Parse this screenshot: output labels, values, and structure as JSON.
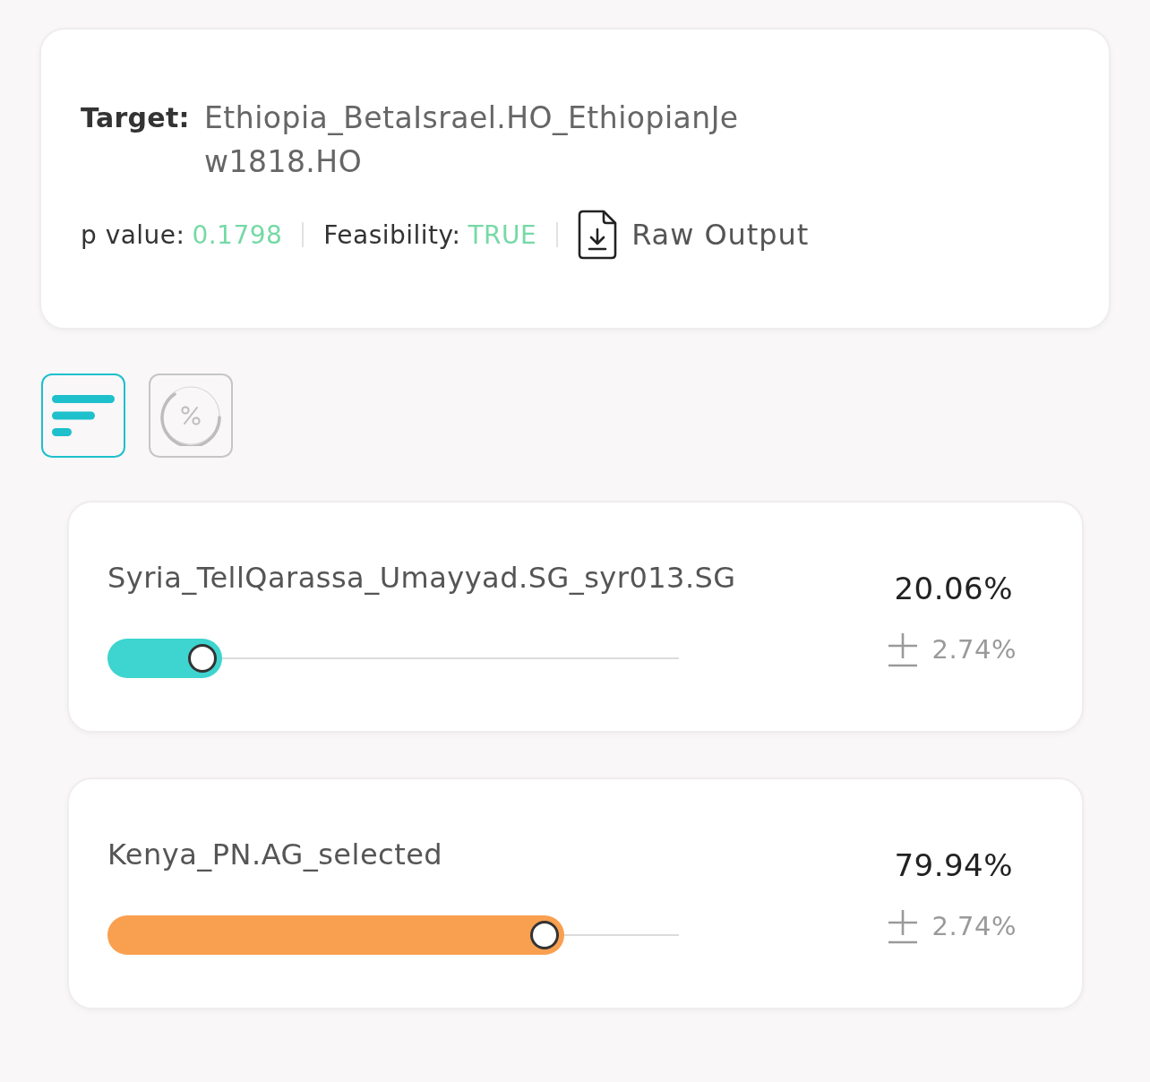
{
  "target": {
    "label": "Target:",
    "value": "Ethiopia_BetaIsrael.HO_EthiopianJew1818.HO"
  },
  "stats": [
    {
      "label": "p value:",
      "value": "0.1798"
    },
    {
      "label": "Feasibility:",
      "value": "TRUE"
    }
  ],
  "raw_output": {
    "label": "Raw Output"
  },
  "view_buttons": [
    {
      "kind": "bars",
      "selected": true
    },
    {
      "kind": "ring",
      "selected": false
    }
  ],
  "sources": [
    {
      "name": "Syria_TellQarassa_Umayyad.SG_syr013.SG",
      "percent": "20.06%",
      "error": "2.74%",
      "level": 0.2006,
      "color": "#3ed4cf"
    },
    {
      "name": "Kenya_PN.AG_selected",
      "percent": "79.94%",
      "error": "2.74%",
      "level": 0.7994,
      "color": "#f9a050"
    }
  ]
}
